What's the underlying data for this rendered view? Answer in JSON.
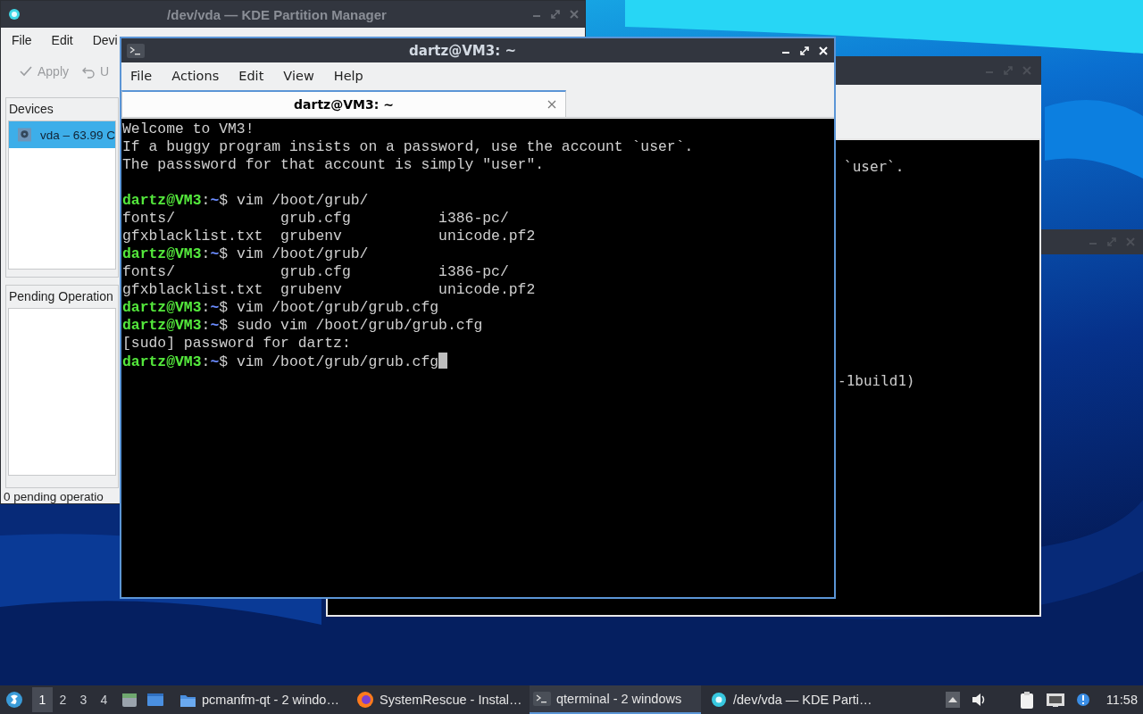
{
  "partition_manager": {
    "title": "/dev/vda — KDE Partition Manager",
    "menu": [
      "File",
      "Edit",
      "Devi"
    ],
    "toolbar": [
      {
        "kind": "apply",
        "label": "Apply",
        "disabled": true
      },
      {
        "kind": "undo",
        "label": "U",
        "disabled": true
      }
    ],
    "devices_panel": {
      "title": "Devices",
      "items": [
        {
          "label": "vda – 63.99 C",
          "selected": true
        }
      ]
    },
    "pending_panel": {
      "title": "Pending Operation"
    },
    "status_bar": "0 pending operatio"
  },
  "back_terminal": {
    "lines": [
      "`user`.",
      "-1build1)"
    ]
  },
  "terminal": {
    "title": "dartz@VM3: ~",
    "menu": [
      "File",
      "Actions",
      "Edit",
      "View",
      "Help"
    ],
    "tabs": [
      {
        "label": "dartz@VM3: ~",
        "selected": true
      }
    ],
    "lines": [
      {
        "kind": "output",
        "text": "Welcome to VM3!"
      },
      {
        "kind": "output",
        "text": "If a buggy program insists on a password, use the account `user`."
      },
      {
        "kind": "output",
        "text": "The passsword for that account is simply \"user\"."
      },
      {
        "kind": "blank"
      },
      {
        "kind": "prompt",
        "host": "dartz@VM3",
        "colon": ":",
        "path": "~",
        "command": "$ vim /boot/grub/",
        "cursor": false
      },
      {
        "kind": "output",
        "text": "fonts/            grub.cfg          i386-pc/"
      },
      {
        "kind": "output",
        "text": "gfxblacklist.txt  grubenv           unicode.pf2"
      },
      {
        "kind": "prompt",
        "host": "dartz@VM3",
        "colon": ":",
        "path": "~",
        "command": "$ vim /boot/grub/",
        "cursor": false
      },
      {
        "kind": "output",
        "text": "fonts/            grub.cfg          i386-pc/"
      },
      {
        "kind": "output",
        "text": "gfxblacklist.txt  grubenv           unicode.pf2"
      },
      {
        "kind": "prompt",
        "host": "dartz@VM3",
        "colon": ":",
        "path": "~",
        "command": "$ vim /boot/grub/grub.cfg",
        "cursor": false
      },
      {
        "kind": "prompt",
        "host": "dartz@VM3",
        "colon": ":",
        "path": "~",
        "command": "$ sudo vim /boot/grub/grub.cfg",
        "cursor": false
      },
      {
        "kind": "output",
        "text": "[sudo] password for dartz:"
      },
      {
        "kind": "prompt",
        "host": "dartz@VM3",
        "colon": ":",
        "path": "~",
        "command": "$ vim /boot/grub/grub.cfg",
        "cursor": true
      }
    ]
  },
  "taskbar": {
    "workspaces": [
      {
        "label": "1",
        "selected": true
      },
      {
        "label": "2",
        "selected": false
      },
      {
        "label": "3",
        "selected": false
      },
      {
        "label": "4",
        "selected": false
      }
    ],
    "tasks": [
      {
        "kind": "folder",
        "label": "pcmanfm-qt - 2 windo…",
        "selected": false
      },
      {
        "kind": "browser",
        "label": "SystemRescue - Instal…",
        "selected": false
      },
      {
        "kind": "terminal",
        "label": "qterminal - 2 windows",
        "selected": true
      },
      {
        "kind": "partition",
        "label": "/dev/vda — KDE Parti…",
        "selected": false
      }
    ],
    "clock": "11:58"
  }
}
